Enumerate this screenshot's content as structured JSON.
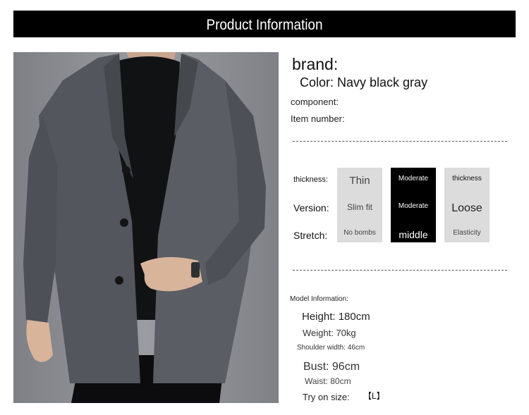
{
  "header": {
    "title": "Product Information"
  },
  "info": {
    "brand": "brand:",
    "color": "Color: Navy black gray",
    "component": "component:",
    "item_number": "Item number:"
  },
  "attributes": {
    "labels": [
      "thickness:",
      "Version:",
      "Stretch:"
    ],
    "columns": [
      {
        "values": [
          "Thin",
          "Slim fit",
          "No bombs"
        ],
        "selected": false
      },
      {
        "values": [
          "Moderate",
          "Moderate",
          "middle"
        ],
        "selected": true
      },
      {
        "values": [
          "thickness",
          "Loose",
          "Elasticity"
        ],
        "selected": false
      }
    ]
  },
  "model": {
    "heading": "Model Information:",
    "height": "Height: 180cm",
    "weight": "Weight: 70kg",
    "shoulder": "Shoulder width: 46cm",
    "bust": "Bust: 96cm",
    "waist": "Waist: 80cm",
    "try_on_label": "Try on size:",
    "try_on_size": "【L】"
  },
  "colors": {
    "header_bg": "#000000",
    "card_bg": "#dcdcdc",
    "card_selected_bg": "#000000"
  }
}
